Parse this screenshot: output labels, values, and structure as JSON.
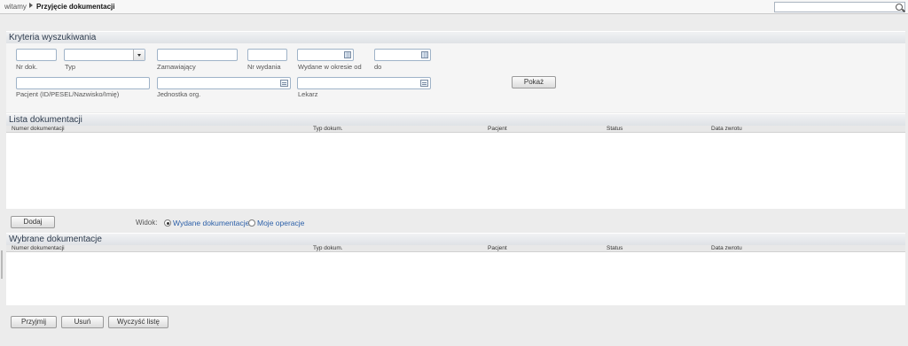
{
  "breadcrumb": {
    "home": "witamy",
    "current": "Przyjęcie dokumentacji"
  },
  "search": {
    "placeholder": "",
    "icon": "search-icon"
  },
  "criteria": {
    "title": "Kryteria wyszukiwania",
    "fields": {
      "nr_dok": {
        "label": "Nr dok.",
        "value": ""
      },
      "typ": {
        "label": "Typ",
        "value": ""
      },
      "zamawiajacy": {
        "label": "Zamawiający",
        "value": ""
      },
      "nr_wydania": {
        "label": "Nr wydania",
        "value": ""
      },
      "wydane_od": {
        "label": "Wydane w okresie od",
        "value": ""
      },
      "do": {
        "label": "do",
        "value": ""
      },
      "pacjent": {
        "label": "Pacjent (ID/PESEL/Nazwisko/Imię)",
        "value": ""
      },
      "jednostka": {
        "label": "Jednostka org.",
        "value": ""
      },
      "lekarz": {
        "label": "Lekarz",
        "value": ""
      }
    },
    "show_button": "Pokaż"
  },
  "documentation_list": {
    "title": "Lista dokumentacji",
    "columns": [
      "Numer dokumentacji",
      "Typ dokum.",
      "Pacjent",
      "Status",
      "Data zwrotu"
    ],
    "rows": []
  },
  "actions": {
    "add_button": "Dodaj",
    "view_label": "Widok:",
    "view_options": [
      {
        "label": "Wydane dokumentacje",
        "selected": true
      },
      {
        "label": "Moje operacje",
        "selected": false
      }
    ]
  },
  "selected_documentation": {
    "title": "Wybrane dokumentacje",
    "columns": [
      "Numer dokumentacji",
      "Typ dokum.",
      "Pacjent",
      "Status",
      "Data zwrotu"
    ],
    "rows": []
  },
  "bottom_actions": {
    "accept_button": "Przyjmij",
    "remove_button": "Usuń",
    "clear_button": "Wyczyść listę"
  }
}
